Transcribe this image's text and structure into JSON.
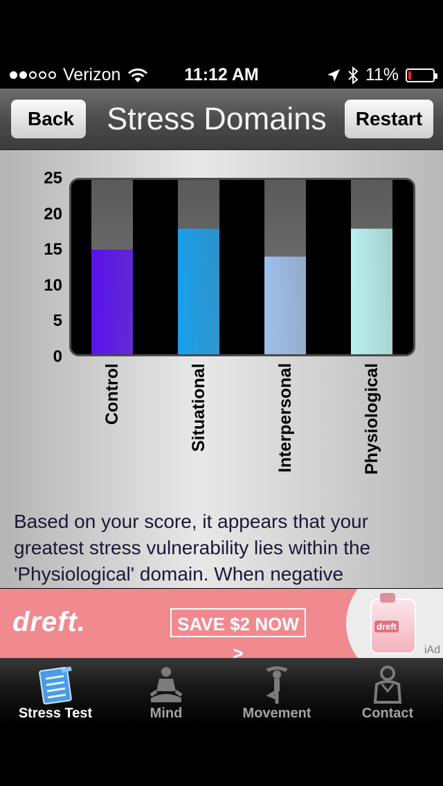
{
  "status_bar": {
    "carrier": "Verizon",
    "time": "11:12 AM",
    "battery": "11%",
    "battery_level": 0.11,
    "signal_bars_filled": 2,
    "signal_bars_total": 5
  },
  "navbar": {
    "back_label": "Back",
    "title": "Stress Domains",
    "restart_label": "Restart"
  },
  "chart_data": {
    "type": "bar",
    "categories": [
      "Control",
      "Situational",
      "Interpersonal",
      "Physiological"
    ],
    "values": [
      15,
      18,
      14,
      18
    ],
    "max": [
      25,
      25,
      25,
      25
    ],
    "yticks": [
      "25",
      "20",
      "15",
      "10",
      "5",
      "0"
    ],
    "ylim": [
      0,
      25
    ],
    "title": "",
    "xlabel": "",
    "ylabel": "",
    "colors": [
      "#5b12ee",
      "#1aa0ea",
      "#9fbfeb",
      "#b8f2f0"
    ],
    "track_color": "#6e6e6e"
  },
  "description": "Based on your score, it appears that your greatest stress vulnerability lies within the 'Physiological' domain. When negative",
  "ad": {
    "brand": "dreft.",
    "cta": "SAVE $2 NOW >",
    "bottle_label": "dreft",
    "provider": "iAd"
  },
  "tabs": [
    {
      "label": "Stress Test",
      "icon": "clipboard-icon",
      "active": true
    },
    {
      "label": "Mind",
      "icon": "meditation-icon",
      "active": false
    },
    {
      "label": "Movement",
      "icon": "yoga-pose-icon",
      "active": false
    },
    {
      "label": "Contact",
      "icon": "person-contact-icon",
      "active": false
    }
  ]
}
